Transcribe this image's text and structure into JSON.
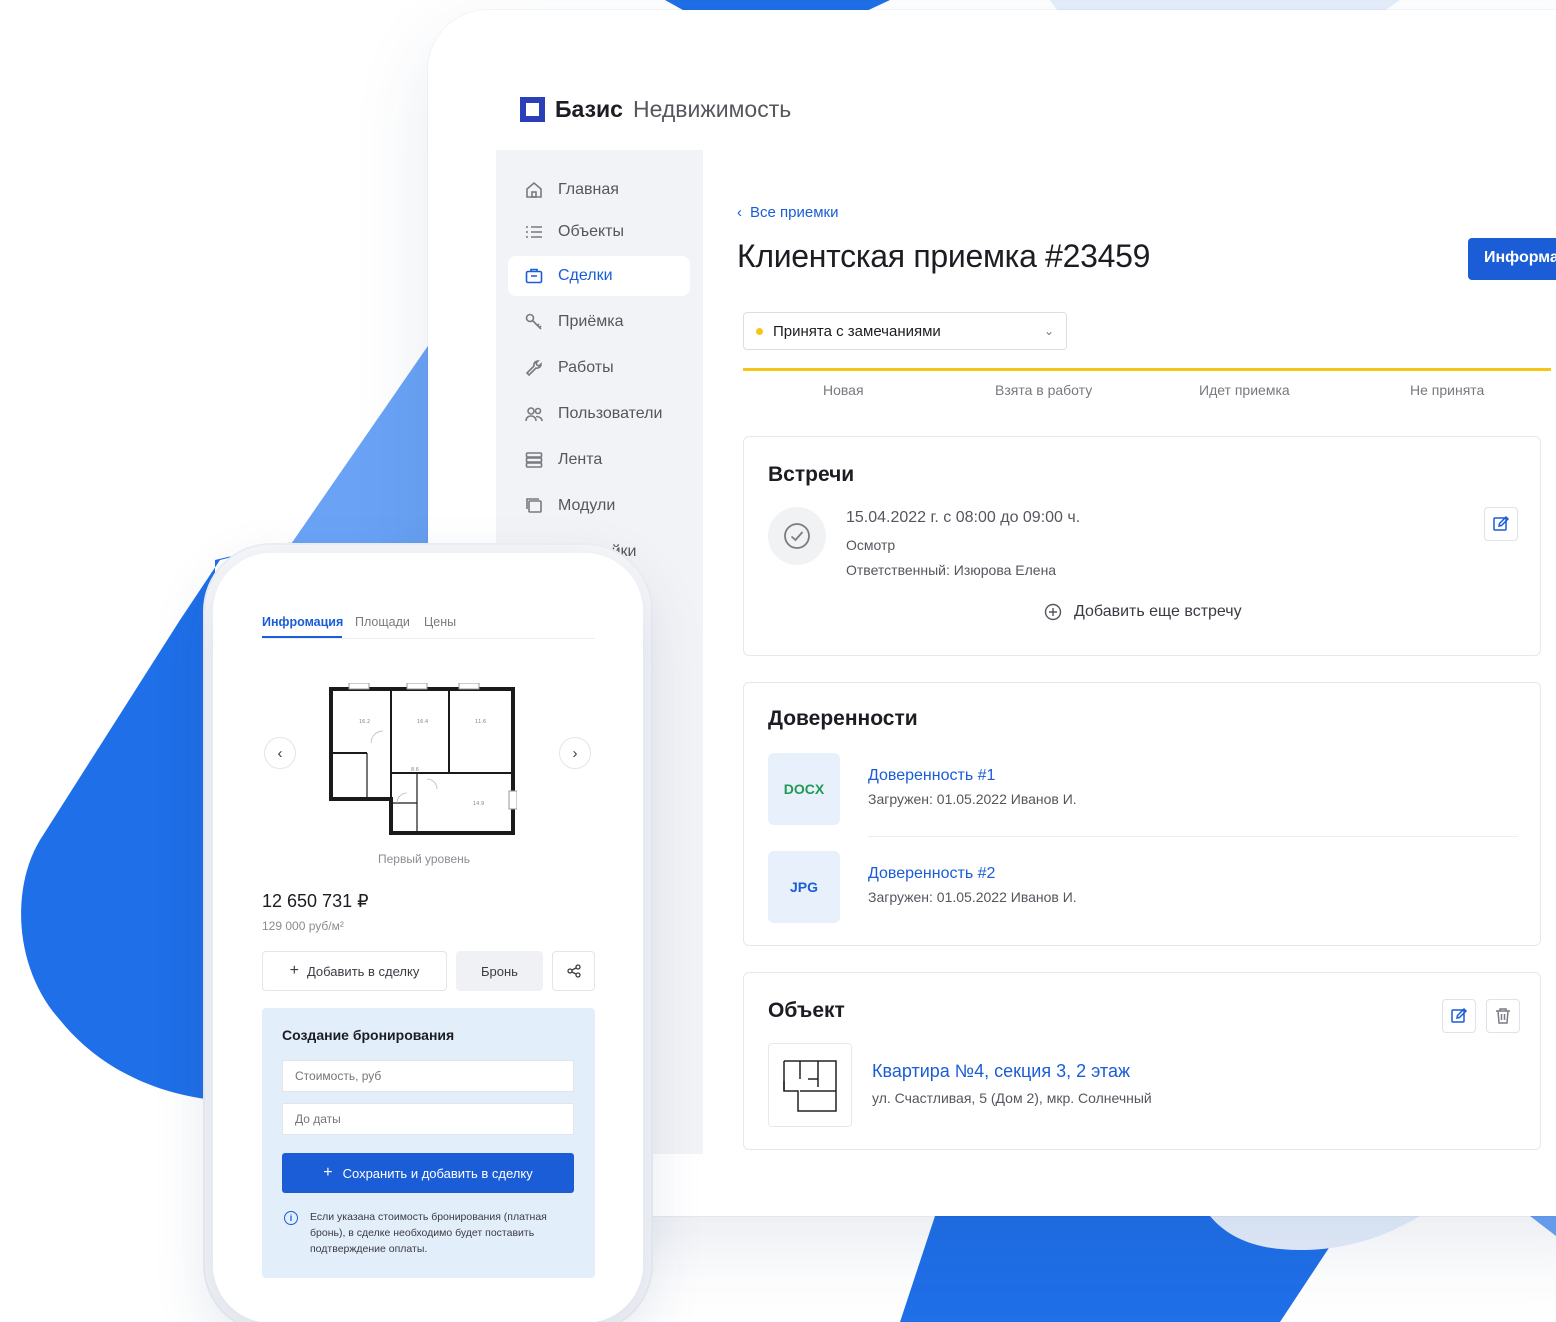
{
  "brand": {
    "strong": "Базис",
    "light": "Недвижимость"
  },
  "sidebar": {
    "items": [
      {
        "label": "Главная",
        "icon": "home-icon",
        "active": false
      },
      {
        "label": "Объекты",
        "icon": "list-icon",
        "active": false
      },
      {
        "label": "Сделки",
        "icon": "briefcase-icon",
        "active": true
      },
      {
        "label": "Приёмка",
        "icon": "key-icon",
        "active": false
      },
      {
        "label": "Работы",
        "icon": "wrench-icon",
        "active": false
      },
      {
        "label": "Пользователи",
        "icon": "users-icon",
        "active": false
      },
      {
        "label": "Лента",
        "icon": "stack-icon",
        "active": false
      },
      {
        "label": "Модули",
        "icon": "modules-icon",
        "active": false
      },
      {
        "label": "Настройки",
        "icon": "gear-icon",
        "active": false
      }
    ]
  },
  "header": {
    "back_label": "Все приемки",
    "title": "Клиентская приемка #23459",
    "info_button": "Информация"
  },
  "status": {
    "current": "Принята с замечаниями",
    "color": "#f5c518",
    "steps": [
      "Новая",
      "Взята в работу",
      "Идет приемка",
      "Не принята"
    ]
  },
  "meetings": {
    "title": "Встречи",
    "date": "15.04.2022 г. с 08:00 до 09:00 ч.",
    "type": "Осмотр",
    "responsible": "Ответственный: Изюрова Елена",
    "add_label": "Добавить еще встречу"
  },
  "powers": {
    "title": "Доверенности",
    "docs": [
      {
        "badge": "DOCX",
        "badge_color": "#1f9a56",
        "name": "Доверенность #1",
        "meta": "Загружен: 01.05.2022 Иванов И."
      },
      {
        "badge": "JPG",
        "badge_color": "#1a5dd6",
        "name": "Доверенность #2",
        "meta": "Загружен: 01.05.2022 Иванов И."
      }
    ]
  },
  "object": {
    "title": "Объект",
    "name": "Квартира №4, секция 3, 2 этаж",
    "address": "ул. Счастливая, 5 (Дом 2), мкр. Солнечный"
  },
  "phone": {
    "tabs": [
      "Инфромация",
      "Площади",
      "Цены"
    ],
    "floor_label": "Первый уровень",
    "price": "12 650 731 ₽",
    "price_per_m": "129 000 руб/м²",
    "add_to_deal": "Добавить в сделку",
    "reserve": "Бронь",
    "booking": {
      "title": "Создание бронирования",
      "cost_placeholder": "Стоимость, руб",
      "date_placeholder": "До даты",
      "save_label": "Сохранить и добавить в сделку",
      "note": "Если указана стоимость бронирования (платная бронь), в сделке необходимо будет поставить подтверждение оплаты."
    }
  },
  "colors": {
    "accent": "#1a5dd6",
    "brand": "#2a3fb8",
    "status": "#f5c518",
    "decor_blue": "#1f6fe8"
  }
}
